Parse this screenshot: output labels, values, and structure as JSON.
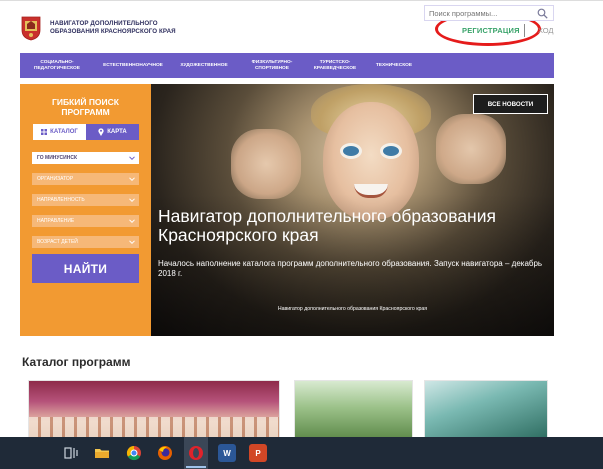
{
  "header": {
    "brand_line1": "НАВИГАТОР ДОПОЛНИТЕЛЬНОГО",
    "brand_line2": "ОБРАЗОВАНИЯ КРАСНОЯРСКОГО КРАЯ",
    "register_label": "РЕГИСТРАЦИЯ",
    "login_label": "ХОД"
  },
  "nav": {
    "items": [
      {
        "line1": "СОЦИАЛЬНО-",
        "line2": "ПЕДАГОГИЧЕСКОЕ"
      },
      {
        "line1": "ЕСТЕСТВЕННОНАУЧНОЕ",
        "line2": ""
      },
      {
        "line1": "ХУДОЖЕСТВЕННОЕ",
        "line2": ""
      },
      {
        "line1": "ФИЗКУЛЬТУРНО-",
        "line2": "СПОРТИВНОЕ"
      },
      {
        "line1": "ТУРИСТСКО-",
        "line2": "КРАЕВЕДЧЕСКОЕ"
      },
      {
        "line1": "ТЕХНИЧЕСКОЕ",
        "line2": ""
      }
    ],
    "search_placeholder": "Поиск программы..."
  },
  "filter": {
    "title_line1": "ГИБКИЙ ПОИСК",
    "title_line2": "ПРОГРАММ",
    "tab_catalog": "КАТАЛОГ",
    "tab_map": "КАРТА",
    "selects": [
      "ГО МИНУСИНСК",
      "ОРГАНИЗАТОР",
      "НАПРАВЛЕННОСТЬ",
      "НАПРАВЛЕНИЕ",
      "ВОЗРАСТ ДЕТЕЙ"
    ],
    "find_label": "НАЙТИ"
  },
  "hero": {
    "news_label": "ВСЕ НОВОСТИ",
    "title": "Навигатор дополнительного образования Красноярского края",
    "subtitle": "Началось наполнение каталога программ дополнительного образования. Запуск навигатора – декабрь 2018 г.",
    "caption": "Навигатор дополнительного образования Красноярского края"
  },
  "catalog": {
    "title": "Каталог программ"
  },
  "taskbar": {
    "word_label": "W",
    "ppt_label": "P"
  },
  "colors": {
    "nav_purple": "#6b5cc6",
    "panel_orange": "#f29a32",
    "register_green": "#39a36a",
    "highlight_red": "#e51b1b",
    "taskbar": "#1f2a38"
  }
}
